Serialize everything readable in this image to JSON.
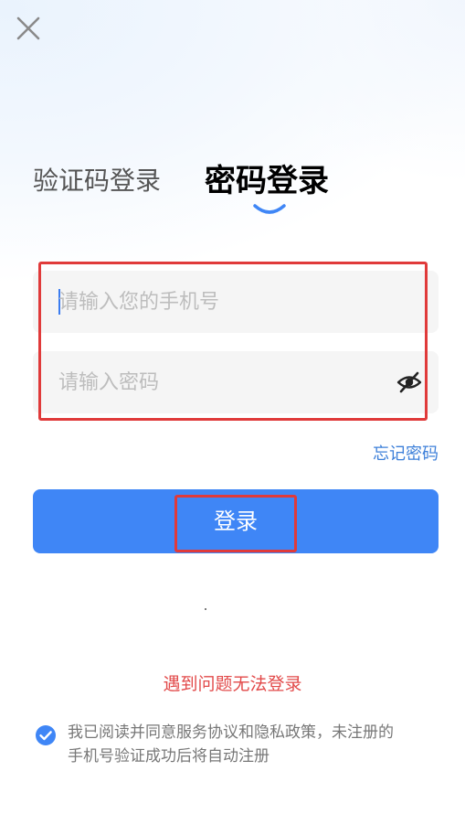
{
  "header": {
    "close_icon": "close-icon"
  },
  "tabs": {
    "sms_login": "验证码登录",
    "password_login": "密码登录",
    "active": "password_login"
  },
  "form": {
    "phone_placeholder": "请输入您的手机号",
    "phone_value": "",
    "password_placeholder": "请输入密码",
    "password_value": "",
    "password_toggle_icon": "eye-off-icon",
    "forgot_password": "忘记密码",
    "login_button": "登录"
  },
  "footer": {
    "help_link": "遇到问题无法登录",
    "agreement_checked": true,
    "agreement_line1": "我已阅读并同意服务协议和隐私政策，未注册的",
    "agreement_line2": "手机号验证成功后将自动注册"
  },
  "colors": {
    "primary": "#3f86f6",
    "link": "#3c7fd9",
    "highlight": "#e03a3a",
    "help_text": "#e24a4a"
  }
}
